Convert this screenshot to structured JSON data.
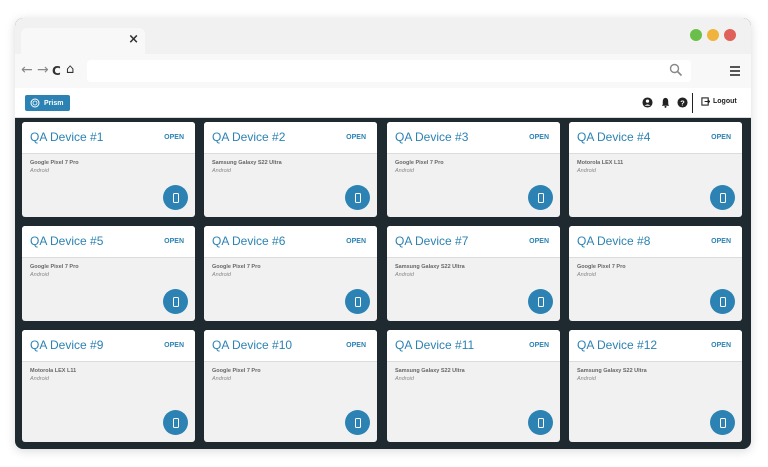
{
  "browser": {
    "tab_close": "×",
    "nav_back": "←",
    "nav_forward": "→",
    "nav_reload": "C",
    "nav_home": "⌂",
    "url": "",
    "dots": [
      "#6abf4b",
      "#f0b43c",
      "#e0605a"
    ]
  },
  "app": {
    "brand": "Prism",
    "logout_label": "Logout",
    "header_icons": [
      "account-icon",
      "bell-icon",
      "help-icon"
    ]
  },
  "devices": [
    {
      "title": "QA Device #1",
      "action": "OPEN",
      "model": "Google Pixel 7 Pro",
      "os": "Android"
    },
    {
      "title": "QA Device #2",
      "action": "OPEN",
      "model": "Samsung Galaxy S22 Ultra",
      "os": "Android"
    },
    {
      "title": "QA Device #3",
      "action": "OPEN",
      "model": "Google Pixel 7 Pro",
      "os": "Android"
    },
    {
      "title": "QA Device #4",
      "action": "OPEN",
      "model": "Motorola LEX L11",
      "os": "Android"
    },
    {
      "title": "QA Device #5",
      "action": "OPEN",
      "model": "Google Pixel 7 Pro",
      "os": "Android"
    },
    {
      "title": "QA Device #6",
      "action": "OPEN",
      "model": "Google Pixel 7 Pro",
      "os": "Android"
    },
    {
      "title": "QA Device #7",
      "action": "OPEN",
      "model": "Samsung Galaxy S22 Ultra",
      "os": "Android"
    },
    {
      "title": "QA Device #8",
      "action": "OPEN",
      "model": "Google Pixel 7 Pro",
      "os": "Android"
    },
    {
      "title": "QA Device #9",
      "action": "OPEN",
      "model": "Motorola LEX L11",
      "os": "Android"
    },
    {
      "title": "QA Device #10",
      "action": "OPEN",
      "model": "Google Pixel 7 Pro",
      "os": "Android"
    },
    {
      "title": "QA Device #11",
      "action": "OPEN",
      "model": "Samsung Galaxy S22 Ultra",
      "os": "Android"
    },
    {
      "title": "QA Device #12",
      "action": "OPEN",
      "model": "Samsung Galaxy S22 Ultra",
      "os": "Android"
    }
  ]
}
